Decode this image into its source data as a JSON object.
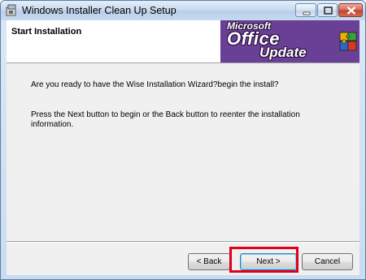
{
  "window": {
    "title": "Windows Installer Clean Up Setup"
  },
  "header": {
    "title": "Start Installation",
    "logo": {
      "line1": "Microsoft",
      "line2": "Office",
      "line3": "Update"
    }
  },
  "body": {
    "question": "Are you ready to have the Wise Installation Wizard?begin the install?",
    "instructions": "Press the Next button to begin or the Back button to reenter the installation information."
  },
  "buttons": {
    "back": "< Back",
    "next": "Next >",
    "cancel": "Cancel"
  },
  "colors": {
    "logo_background": "#6a3f96",
    "highlight": "#e0001a"
  }
}
